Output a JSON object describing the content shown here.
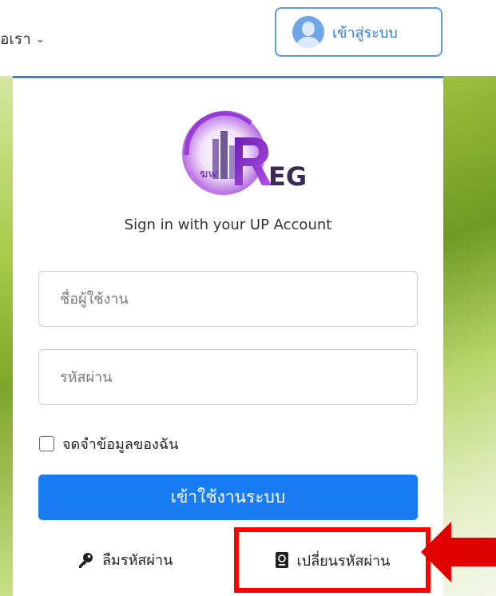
{
  "topbar": {
    "about_label": "อเรา",
    "login_label": "เข้าสู่ระบบ"
  },
  "card": {
    "logo_text": "EG",
    "subtitle": "Sign in with your UP Account",
    "username_placeholder": "ชื่อผู้ใช้งาน",
    "password_placeholder": "รหัสผ่าน",
    "remember_label": "จดจำข้อมูลของฉัน",
    "submit_label": "เข้าใช้งานระบบ",
    "forgot_label": "ลืมรหัสผ่าน",
    "change_label": "เปลี่ยนรหัสผ่าน"
  },
  "colors": {
    "accent": "#1a7cf2",
    "highlight": "#ff0000",
    "logo_purple": "#8e2bd6"
  },
  "icons": {
    "avatar": "user-avatar-icon",
    "forgot": "key-icon",
    "change": "passport-icon",
    "chevron": "chevron-down-icon",
    "arrow": "red-arrow-left-icon"
  }
}
